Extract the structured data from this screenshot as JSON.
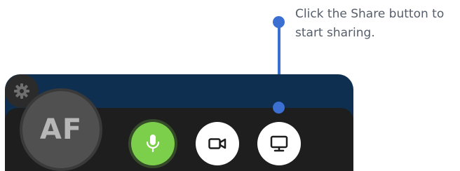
{
  "callout": {
    "line1": "Click the Share button to",
    "line2": "start sharing.",
    "accent_color": "#3b6fd1"
  },
  "participant": {
    "initials": "AF"
  },
  "controls": {
    "microphone": {
      "icon": "microphone-icon",
      "state": "on",
      "color": "#7ccf4b"
    },
    "camera": {
      "icon": "video-camera-icon",
      "state": "off"
    },
    "share": {
      "icon": "monitor-icon"
    },
    "settings": {
      "icon": "gear-icon"
    }
  },
  "colors": {
    "window_bg": "#0e2f4f",
    "bar_bg": "#1e1e1e",
    "avatar_bg": "#505050"
  }
}
